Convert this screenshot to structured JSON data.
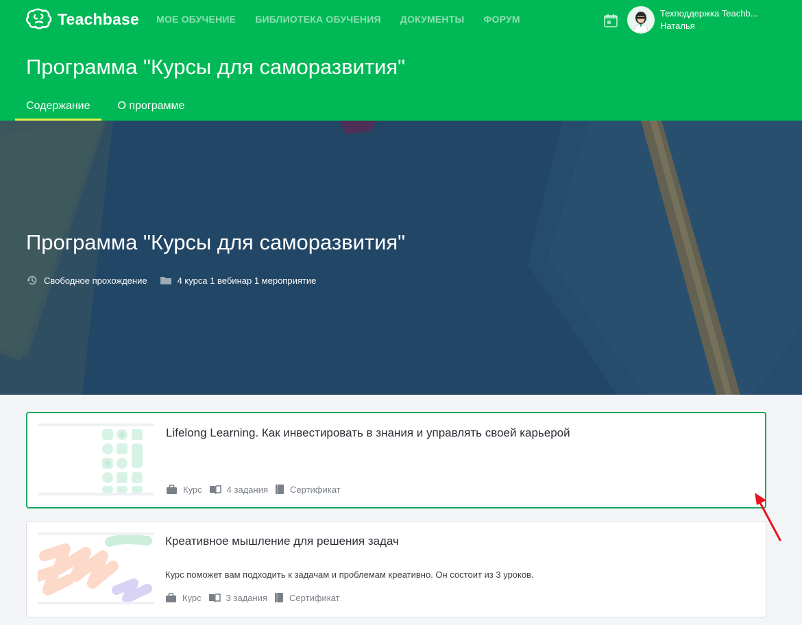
{
  "brand": {
    "name": "Teachbase"
  },
  "nav": {
    "items": [
      {
        "label": "МОЕ ОБУЧЕНИЕ"
      },
      {
        "label": "БИБЛИОТЕКА ОБУЧЕНИЯ"
      },
      {
        "label": "ДОКУМЕНТЫ"
      },
      {
        "label": "ФОРУМ"
      }
    ]
  },
  "user": {
    "name": "Техподдержка Teachb...",
    "subtitle": "Наталья"
  },
  "page": {
    "title": "Программа \"Курсы для саморазвития\""
  },
  "tabs": [
    {
      "label": "Содержание",
      "active": true
    },
    {
      "label": "О программе",
      "active": false
    }
  ],
  "hero": {
    "title": "Программа \"Курсы для саморазвития\"",
    "meta": {
      "mode": "Свободное прохождение",
      "contents": "4 курса 1 вебинар 1 мероприятие"
    }
  },
  "cards": [
    {
      "title": "Lifelong Learning. Как инвестировать в знания и управлять своей карьерой",
      "description": "",
      "type": "Курс",
      "tasks": "4 задания",
      "certificate": "Сертификат",
      "selected": true
    },
    {
      "title": "Креативное мышление для решения задач",
      "description": "Курс поможет вам подходить к задачам и проблемам креативно. Он состоит из 3 уроков.",
      "type": "Курс",
      "tasks": "3 задания",
      "certificate": "Сертификат",
      "selected": false
    }
  ],
  "colors": {
    "brand_green": "#00b956",
    "tab_underline": "#e8f04a",
    "hero_blue": "#264a6a",
    "selected_border": "#1aa861",
    "annotation_arrow": "#e8141e"
  },
  "icons": {
    "logo": "brain-logo-icon",
    "calendar": "calendar-icon",
    "mode": "history-icon",
    "contents": "folder-icon",
    "type": "briefcase-icon",
    "tasks": "book-open-icon",
    "certificate": "certificate-book-icon",
    "annotation": "red-arrow-icon"
  }
}
